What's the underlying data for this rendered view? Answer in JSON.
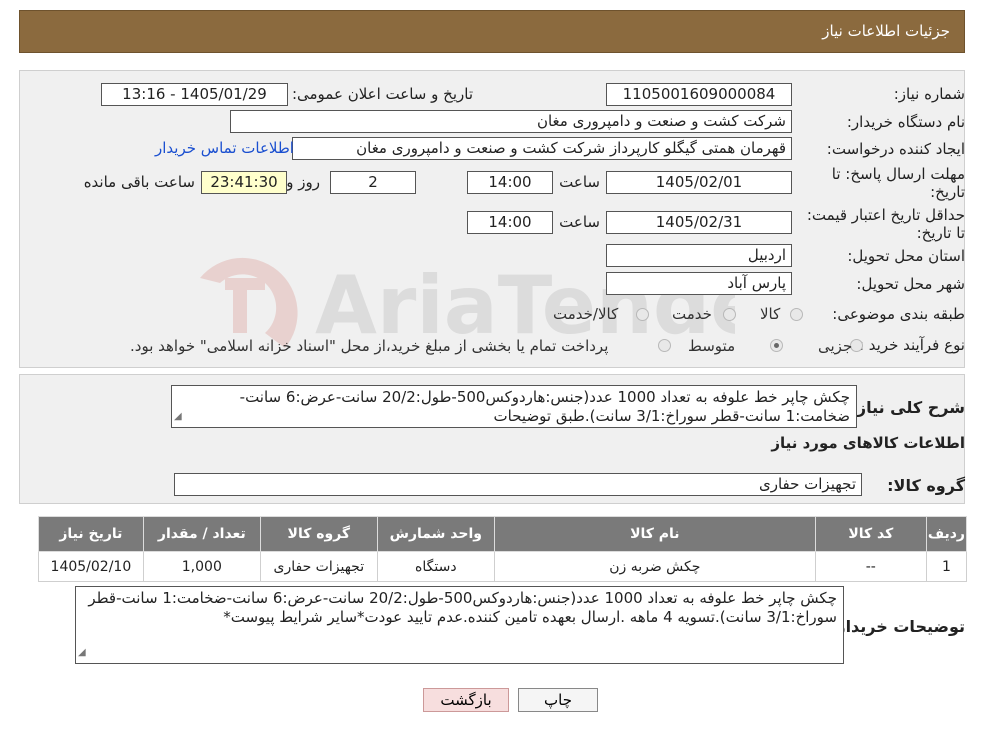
{
  "header": {
    "title": "جزئیات اطلاعات نیاز"
  },
  "watermark": {
    "text": "AriaTender.neT"
  },
  "info": {
    "need_number_label": "شماره نیاز:",
    "need_number": "1105001609000084",
    "announce_label": "تاریخ و ساعت اعلان عمومی:",
    "announce_value": "1405/01/29 - 13:16",
    "buyer_label": "نام دستگاه خریدار:",
    "buyer_value": "شرکت کشت و صنعت و دامپروری مغان",
    "creator_label": "ایجاد کننده درخواست:",
    "creator_value": "قهرمان همتی گیگلو کارپرداز شرکت کشت و صنعت و دامپروری مغان",
    "contact_link": "اطلاعات تماس خریدار",
    "deadline_label": "مهلت ارسال پاسخ: تا تاریخ:",
    "deadline_date": "1405/02/01",
    "time_label": "ساعت",
    "deadline_time": "14:00",
    "days_value": "2",
    "days_label": "روز و",
    "remaining_time": "23:41:30",
    "remaining_label": "ساعت باقی مانده",
    "validity_label": "حداقل تاریخ اعتبار قیمت: تا تاریخ:",
    "validity_date": "1405/02/31",
    "validity_time": "14:00",
    "province_label": "استان محل تحویل:",
    "province_value": "اردبیل",
    "city_label": "شهر محل تحویل:",
    "city_value": "پارس آباد",
    "category_label": "طبقه بندی موضوعی:",
    "category_options": [
      "کالا",
      "خدمت",
      "کالا/خدمت"
    ],
    "process_label": "نوع فرآیند خرید :",
    "process_options": [
      "جزیی",
      "متوسط"
    ],
    "process_note": "پرداخت تمام یا بخشی از مبلغ خرید،از محل \"اسناد خزانه اسلامی\" خواهد بود."
  },
  "summary": {
    "label": "شرح کلی نیاز:",
    "text": "چکش چاپر خط علوفه به تعداد 1000 عدد(جنس:هاردوکس500-طول:20/2 سانت-عرض:6 سانت-ضخامت:1 سانت-قطر سوراخ:3/1 سانت).طبق توضیحات",
    "goods_info_title": "اطلاعات کالاهای مورد نیاز",
    "group_label": "گروه کالا:",
    "group_value": "تجهیزات حفاری"
  },
  "table": {
    "headers": [
      "ردیف",
      "کد کالا",
      "نام کالا",
      "واحد شمارش",
      "گروه کالا",
      "تعداد / مقدار",
      "تاریخ نیاز"
    ],
    "rows": [
      [
        "1",
        "--",
        "چکش ضربه زن",
        "دستگاه",
        "تجهیزات حفاری",
        "1,000",
        "1405/02/10"
      ]
    ]
  },
  "buyer_notes": {
    "label": "توضیحات خریدار:",
    "text": "چکش چاپر خط علوفه به تعداد 1000 عدد(جنس:هاردوکس500-طول:20/2 سانت-عرض:6 سانت-ضخامت:1 سانت-قطر سوراخ:3/1 سانت).تسویه 4 ماهه .ارسال بعهده تامین کننده.عدم تایید عودت*سایر شرایط پیوست*"
  },
  "buttons": {
    "print": "چاپ",
    "back": "بازگشت"
  }
}
